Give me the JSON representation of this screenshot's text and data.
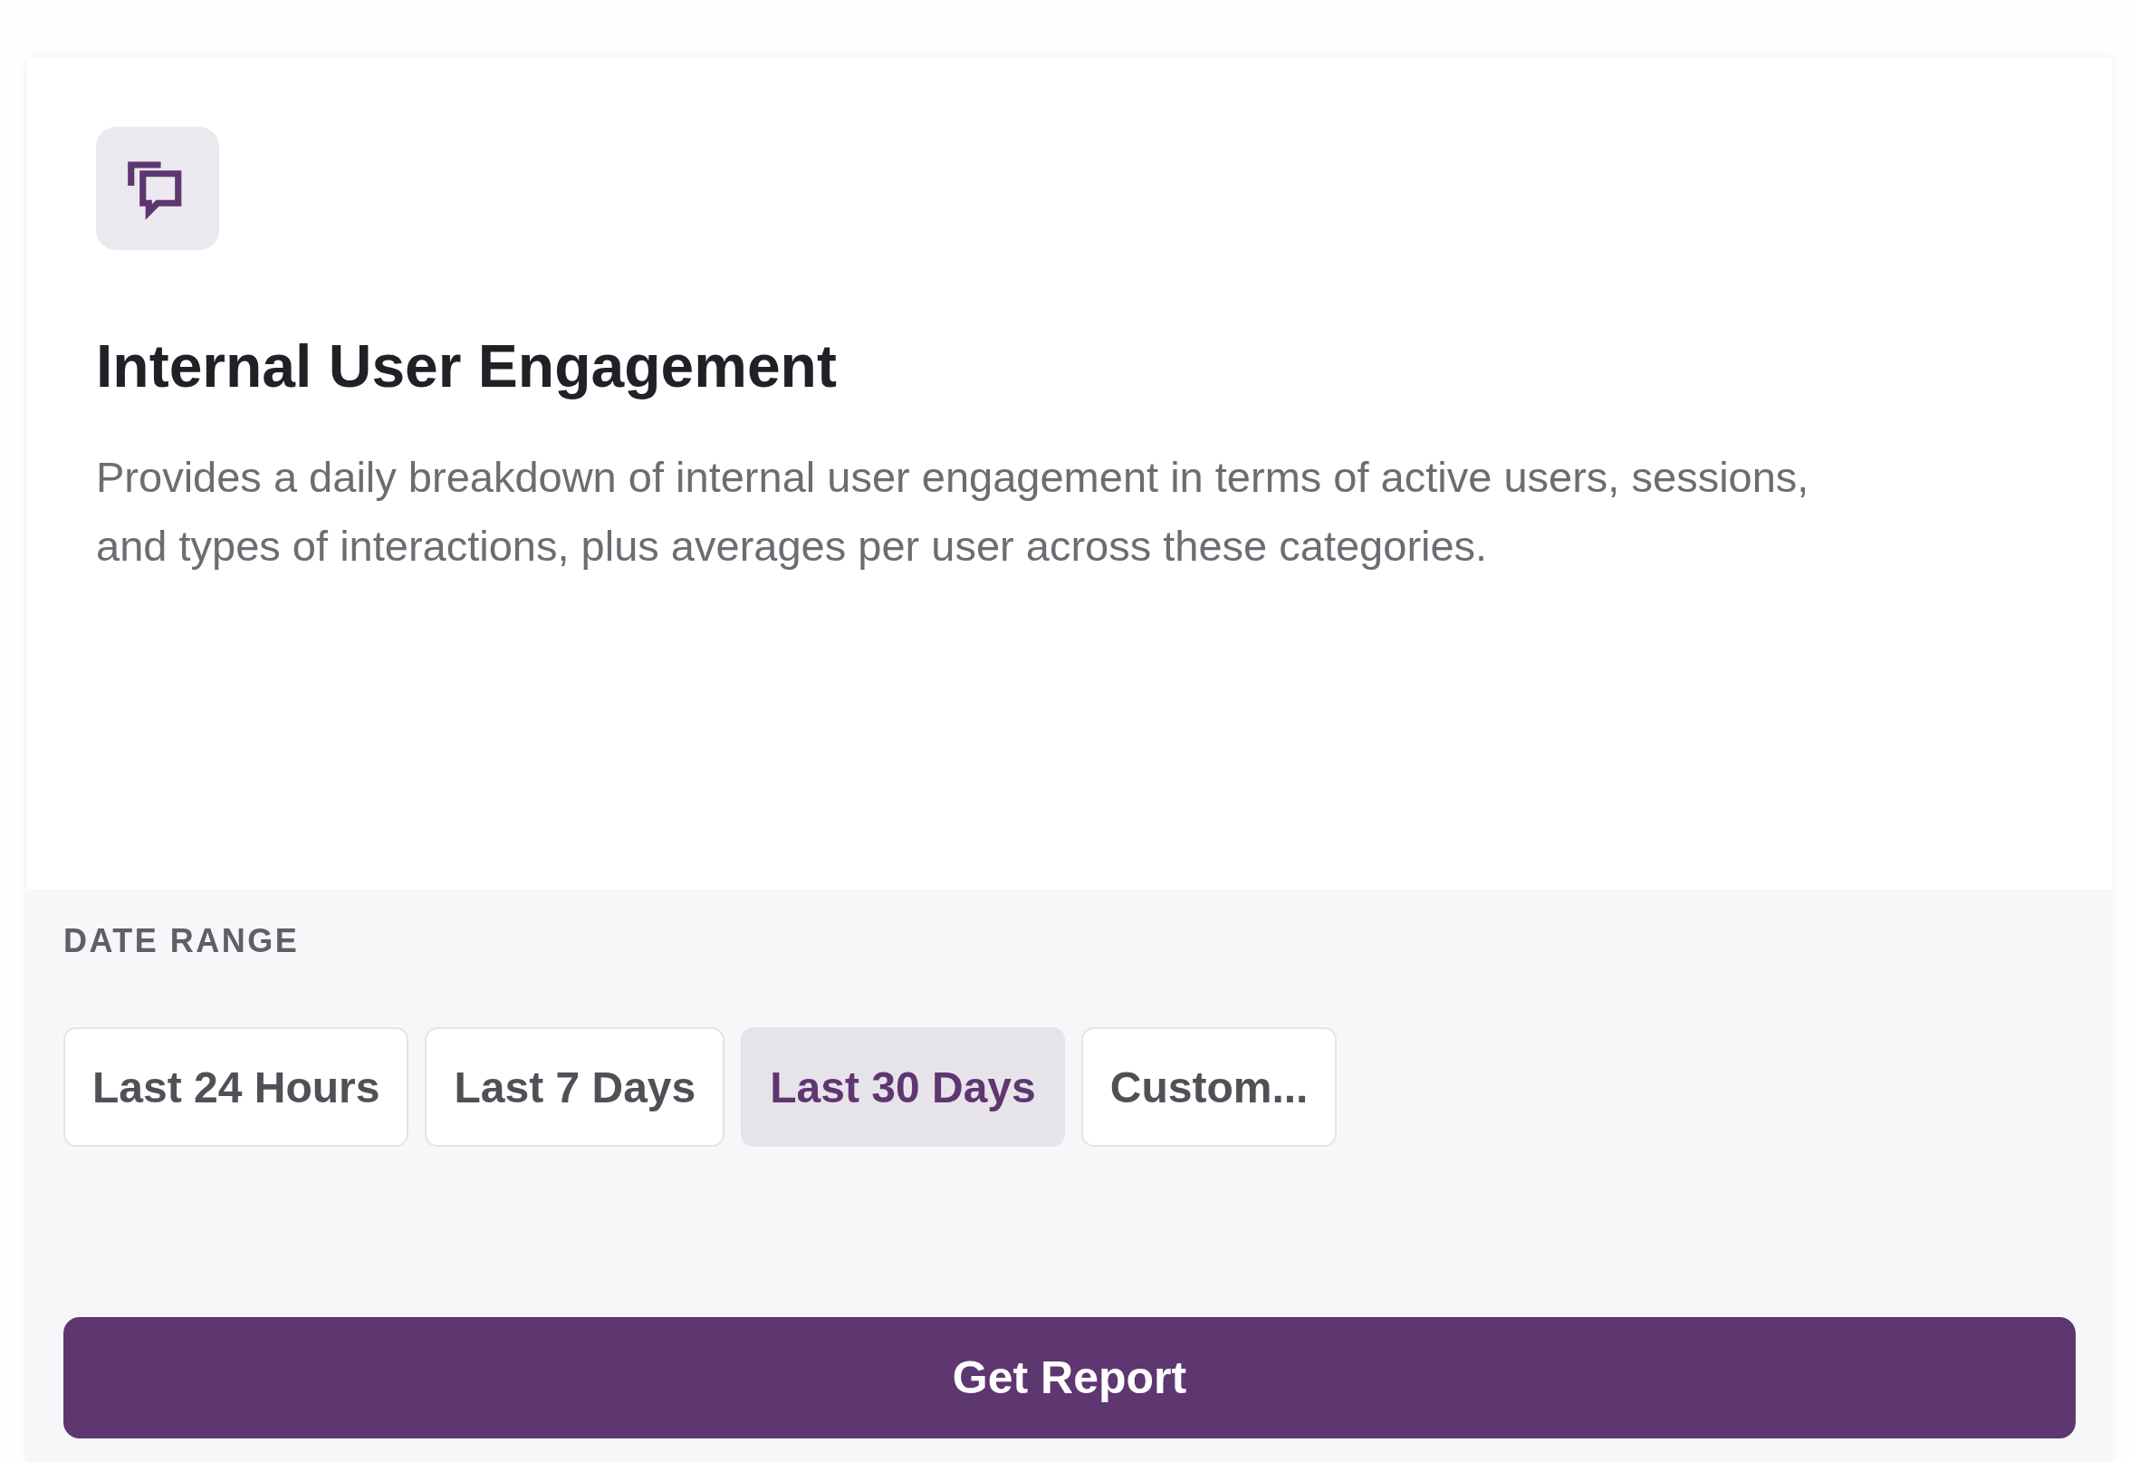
{
  "card": {
    "title": "Internal User Engagement",
    "description": "Provides a daily breakdown of internal user engagement in terms of active users, sessions, and types of interactions, plus averages per user across these categories."
  },
  "date_range": {
    "label": "DATE RANGE",
    "options": [
      {
        "label": "Last 24 Hours",
        "selected": false
      },
      {
        "label": "Last 7 Days",
        "selected": false
      },
      {
        "label": "Last 30 Days",
        "selected": true
      },
      {
        "label": "Custom...",
        "selected": false
      }
    ]
  },
  "submit_button": "Get Report"
}
